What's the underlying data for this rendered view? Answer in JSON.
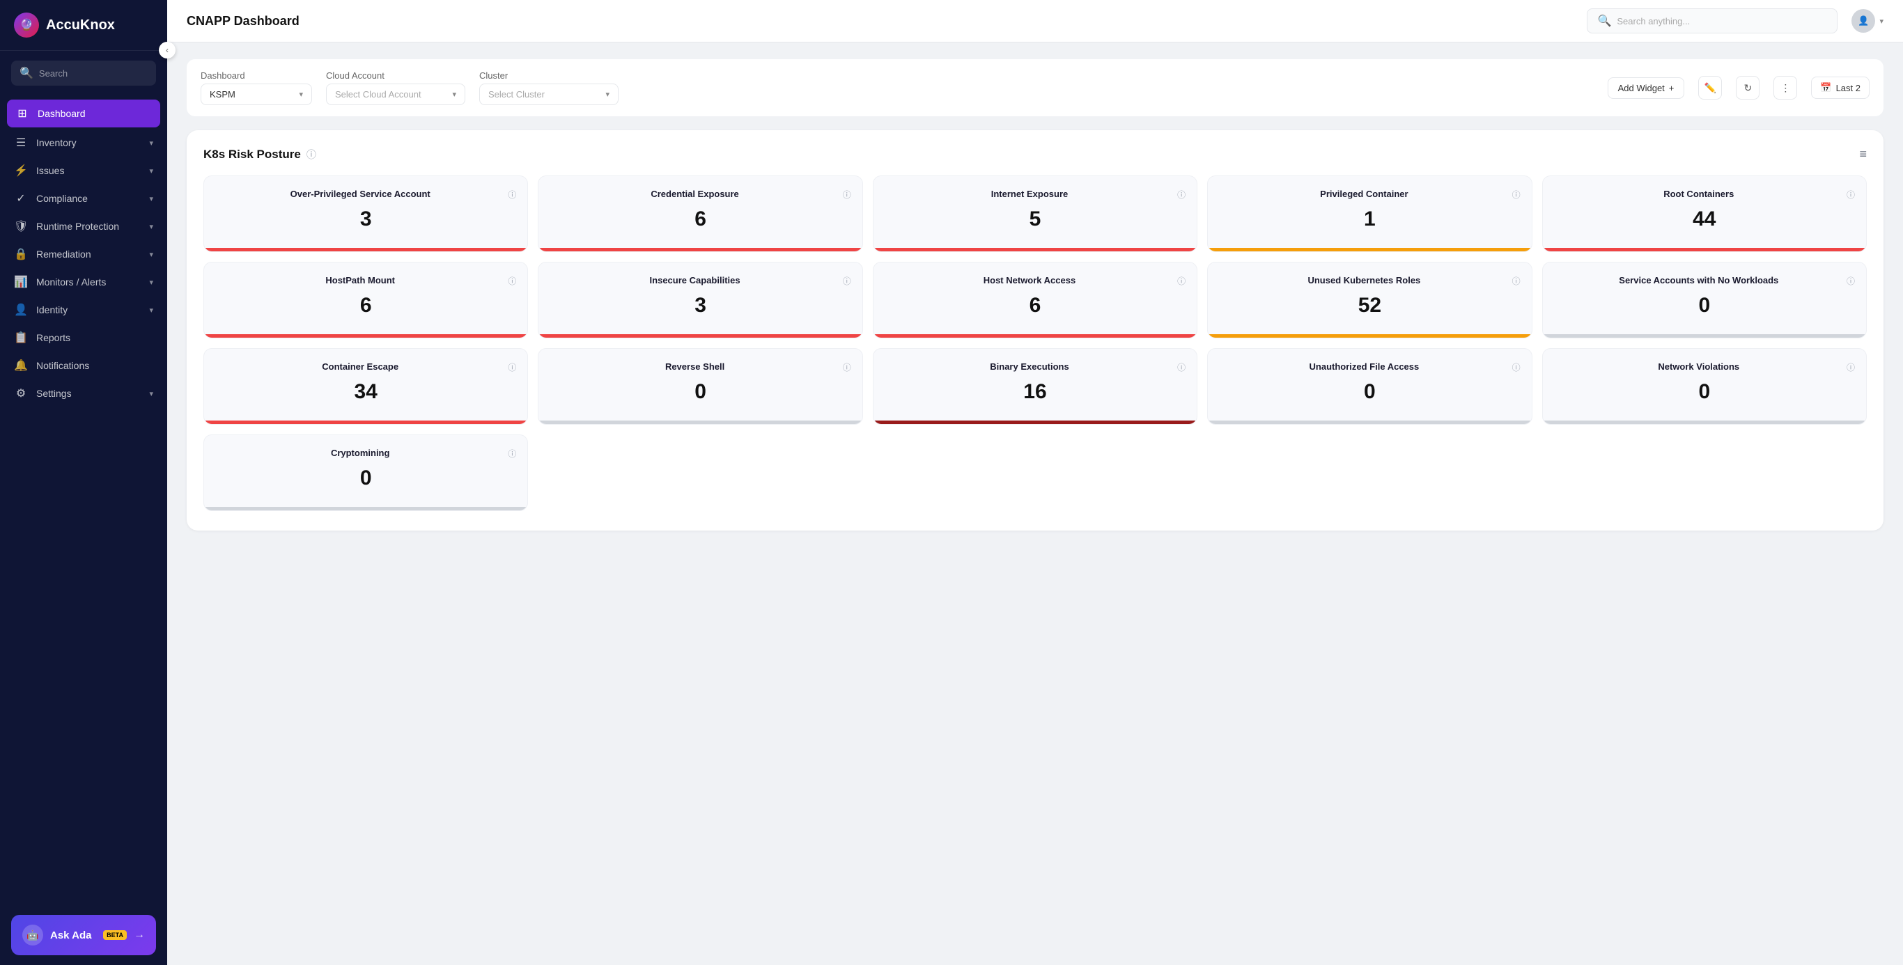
{
  "sidebar": {
    "logo_text": "AccuKnox",
    "search_placeholder": "Search",
    "nav_items": [
      {
        "id": "dashboard",
        "label": "Dashboard",
        "icon": "⊞",
        "active": true,
        "has_chevron": false
      },
      {
        "id": "inventory",
        "label": "Inventory",
        "icon": "☰",
        "active": false,
        "has_chevron": true
      },
      {
        "id": "issues",
        "label": "Issues",
        "icon": "⚡",
        "active": false,
        "has_chevron": true
      },
      {
        "id": "compliance",
        "label": "Compliance",
        "icon": "✓",
        "active": false,
        "has_chevron": true
      },
      {
        "id": "runtime",
        "label": "Runtime Protection",
        "icon": "🛡",
        "active": false,
        "has_chevron": true
      },
      {
        "id": "remediation",
        "label": "Remediation",
        "icon": "🔒",
        "active": false,
        "has_chevron": true
      },
      {
        "id": "monitors",
        "label": "Monitors / Alerts",
        "icon": "📊",
        "active": false,
        "has_chevron": true
      },
      {
        "id": "identity",
        "label": "Identity",
        "icon": "👤",
        "active": false,
        "has_chevron": true
      },
      {
        "id": "reports",
        "label": "Reports",
        "icon": "📋",
        "active": false,
        "has_chevron": false
      },
      {
        "id": "notifications",
        "label": "Notifications",
        "icon": "🔔",
        "active": false,
        "has_chevron": false
      },
      {
        "id": "settings",
        "label": "Settings",
        "icon": "⚙",
        "active": false,
        "has_chevron": true
      }
    ],
    "ask_ada_label": "Ask Ada",
    "ask_ada_beta": "BETA",
    "ask_ada_arrow": "→"
  },
  "topbar": {
    "title": "CNAPP Dashboard",
    "search_placeholder": "Search anything...",
    "date_label": "Last 2"
  },
  "filters": {
    "dashboard_label": "Dashboard",
    "dashboard_value": "KSPM",
    "cloud_account_label": "Cloud Account",
    "cloud_account_placeholder": "Select Cloud Account",
    "cluster_label": "Cluster",
    "cluster_placeholder": "Select Cluster",
    "add_widget_label": "Add Widget",
    "add_widget_icon": "+"
  },
  "k8s_section": {
    "title": "K8s Risk Posture",
    "rows": [
      [
        {
          "id": "over-privileged",
          "title": "Over-Privileged Service Account",
          "value": "3",
          "bar": "red"
        },
        {
          "id": "credential-exposure",
          "title": "Credential Exposure",
          "value": "6",
          "bar": "red"
        },
        {
          "id": "internet-exposure",
          "title": "Internet Exposure",
          "value": "5",
          "bar": "red"
        },
        {
          "id": "privileged-container",
          "title": "Privileged Container",
          "value": "1",
          "bar": "orange"
        },
        {
          "id": "root-containers",
          "title": "Root Containers",
          "value": "44",
          "bar": "red"
        }
      ],
      [
        {
          "id": "hostpath-mount",
          "title": "HostPath Mount",
          "value": "6",
          "bar": "red"
        },
        {
          "id": "insecure-capabilities",
          "title": "Insecure Capabilities",
          "value": "3",
          "bar": "red"
        },
        {
          "id": "host-network-access",
          "title": "Host Network Access",
          "value": "6",
          "bar": "red"
        },
        {
          "id": "unused-kubernetes-roles",
          "title": "Unused Kubernetes Roles",
          "value": "52",
          "bar": "orange"
        },
        {
          "id": "service-accounts-no-workloads",
          "title": "Service Accounts with No Workloads",
          "value": "0",
          "bar": "gray"
        }
      ],
      [
        {
          "id": "container-escape",
          "title": "Container Escape",
          "value": "34",
          "bar": "red"
        },
        {
          "id": "reverse-shell",
          "title": "Reverse Shell",
          "value": "0",
          "bar": "gray"
        },
        {
          "id": "binary-executions",
          "title": "Binary Executions",
          "value": "16",
          "bar": "darkred"
        },
        {
          "id": "unauthorized-file-access",
          "title": "Unauthorized File Access",
          "value": "0",
          "bar": "gray"
        },
        {
          "id": "network-violations",
          "title": "Network Violations",
          "value": "0",
          "bar": "gray"
        }
      ],
      [
        {
          "id": "cryptomining",
          "title": "Cryptomining",
          "value": "0",
          "bar": "gray"
        }
      ]
    ]
  }
}
